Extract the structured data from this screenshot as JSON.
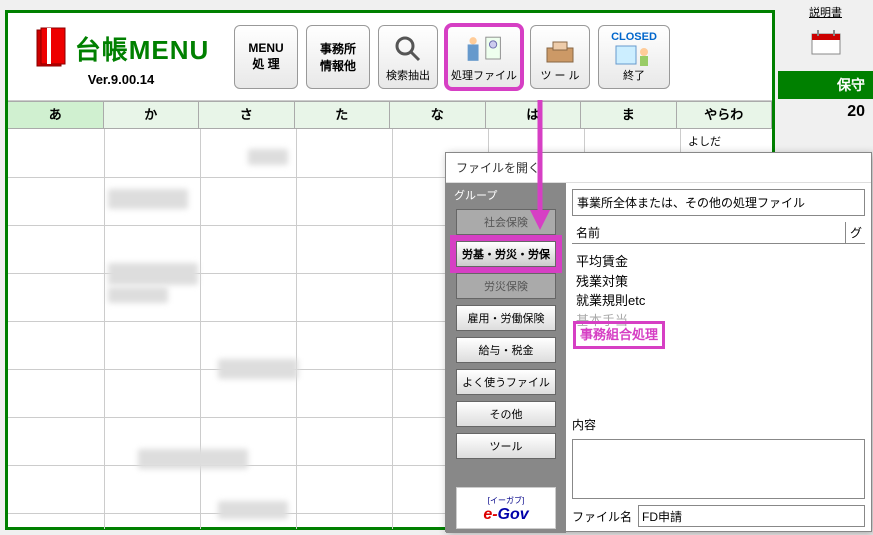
{
  "app": {
    "title": "台帳MENU",
    "version": "Ver.9.00.14"
  },
  "toolbar": {
    "menu_proc": "MENU\n処 理",
    "office_info": "事務所\n情報他",
    "search": "検索抽出",
    "proc_file": "処理ファイル",
    "tool": "ツ ー ル",
    "closed": "CLOSED",
    "end": "終了"
  },
  "right": {
    "manual": "説明書",
    "maint": "保守",
    "year": "20"
  },
  "kana": [
    "あ",
    "か",
    "さ",
    "た",
    "な",
    "は",
    "ま",
    "やらわ"
  ],
  "grid_partial": "よしだ",
  "dialog": {
    "title": "ファイルを開く",
    "group_label": "グループ",
    "context": "事業所全体または、その他の処理ファイル",
    "groups": {
      "g0": "社会保険",
      "g1": "労基・労災・労保",
      "g2": "労災保険",
      "g3": "雇用・労働保険",
      "g4": "給与・税金",
      "g5": "よく使うファイル",
      "g6": "その他",
      "g7": "ツール"
    },
    "name_col": "名前",
    "group_col": "グ",
    "files": {
      "f0": "平均賃金",
      "f1": "残業対策",
      "f2": "就業規則etc",
      "f3": "基本手当",
      "f4": "事務組合処理"
    },
    "content_label": "内容",
    "filename_label": "ファイル名",
    "filename_value": "FD申請",
    "egov_sub": "[イーガブ]"
  }
}
